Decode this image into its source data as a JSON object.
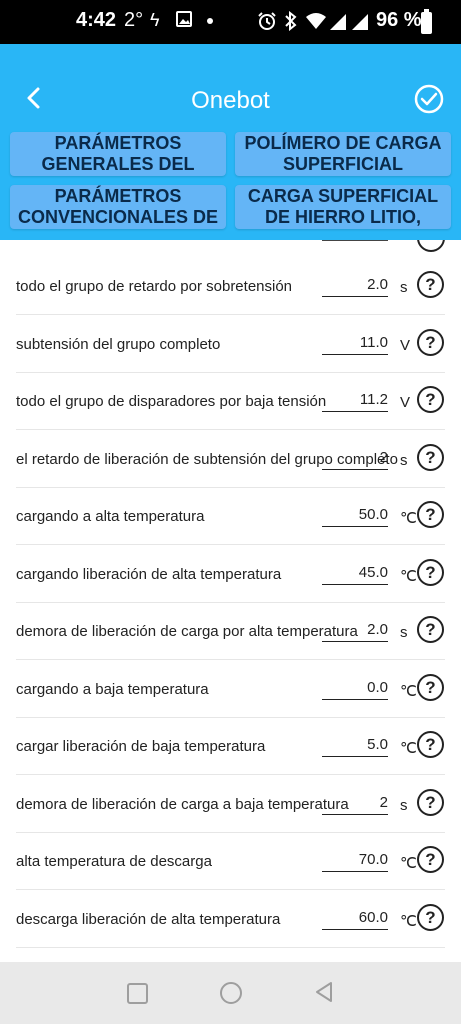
{
  "status_bar": {
    "time": "4:42",
    "temperature": "2°",
    "battery": "96 %"
  },
  "header": {
    "title": "Onebot",
    "background": "#29b6f6"
  },
  "tabs": [
    {
      "label": "PARÁMETROS GENERALES DEL"
    },
    {
      "label": "POLÍMERO DE CARGA SUPERFICIAL DESCARGA"
    },
    {
      "label": "PARÁMETROS CONVENCIONALES DE"
    },
    {
      "label": "CARGA SUPERFICIAL DE HIERRO LITIO, DESCARGA"
    }
  ],
  "rows": [
    {
      "label": "todo el grupo de retardo por sobretensión",
      "value": "2.0",
      "unit": "s"
    },
    {
      "label": "subtensión del grupo completo",
      "value": "11.0",
      "unit": "V"
    },
    {
      "label": "todo el grupo de disparadores por baja tensión",
      "value": "11.2",
      "unit": "V"
    },
    {
      "label": "el retardo de liberación de subtensión del grupo completo",
      "value": "2",
      "unit": "s"
    },
    {
      "label": "cargando a alta temperatura",
      "value": "50.0",
      "unit": "℃"
    },
    {
      "label": "cargando liberación de alta temperatura",
      "value": "45.0",
      "unit": "℃"
    },
    {
      "label": "demora de liberación de carga por alta temperatura",
      "value": "2.0",
      "unit": "s"
    },
    {
      "label": "cargando a baja temperatura",
      "value": "0.0",
      "unit": "℃"
    },
    {
      "label": "cargar liberación de baja temperatura",
      "value": "5.0",
      "unit": "℃"
    },
    {
      "label": "demora de liberación de carga a baja temperatura",
      "value": "2",
      "unit": "s"
    },
    {
      "label": "alta temperatura de descarga",
      "value": "70.0",
      "unit": "℃"
    },
    {
      "label": "descarga liberación de alta temperatura",
      "value": "60.0",
      "unit": "℃"
    }
  ],
  "help_glyph": "?"
}
